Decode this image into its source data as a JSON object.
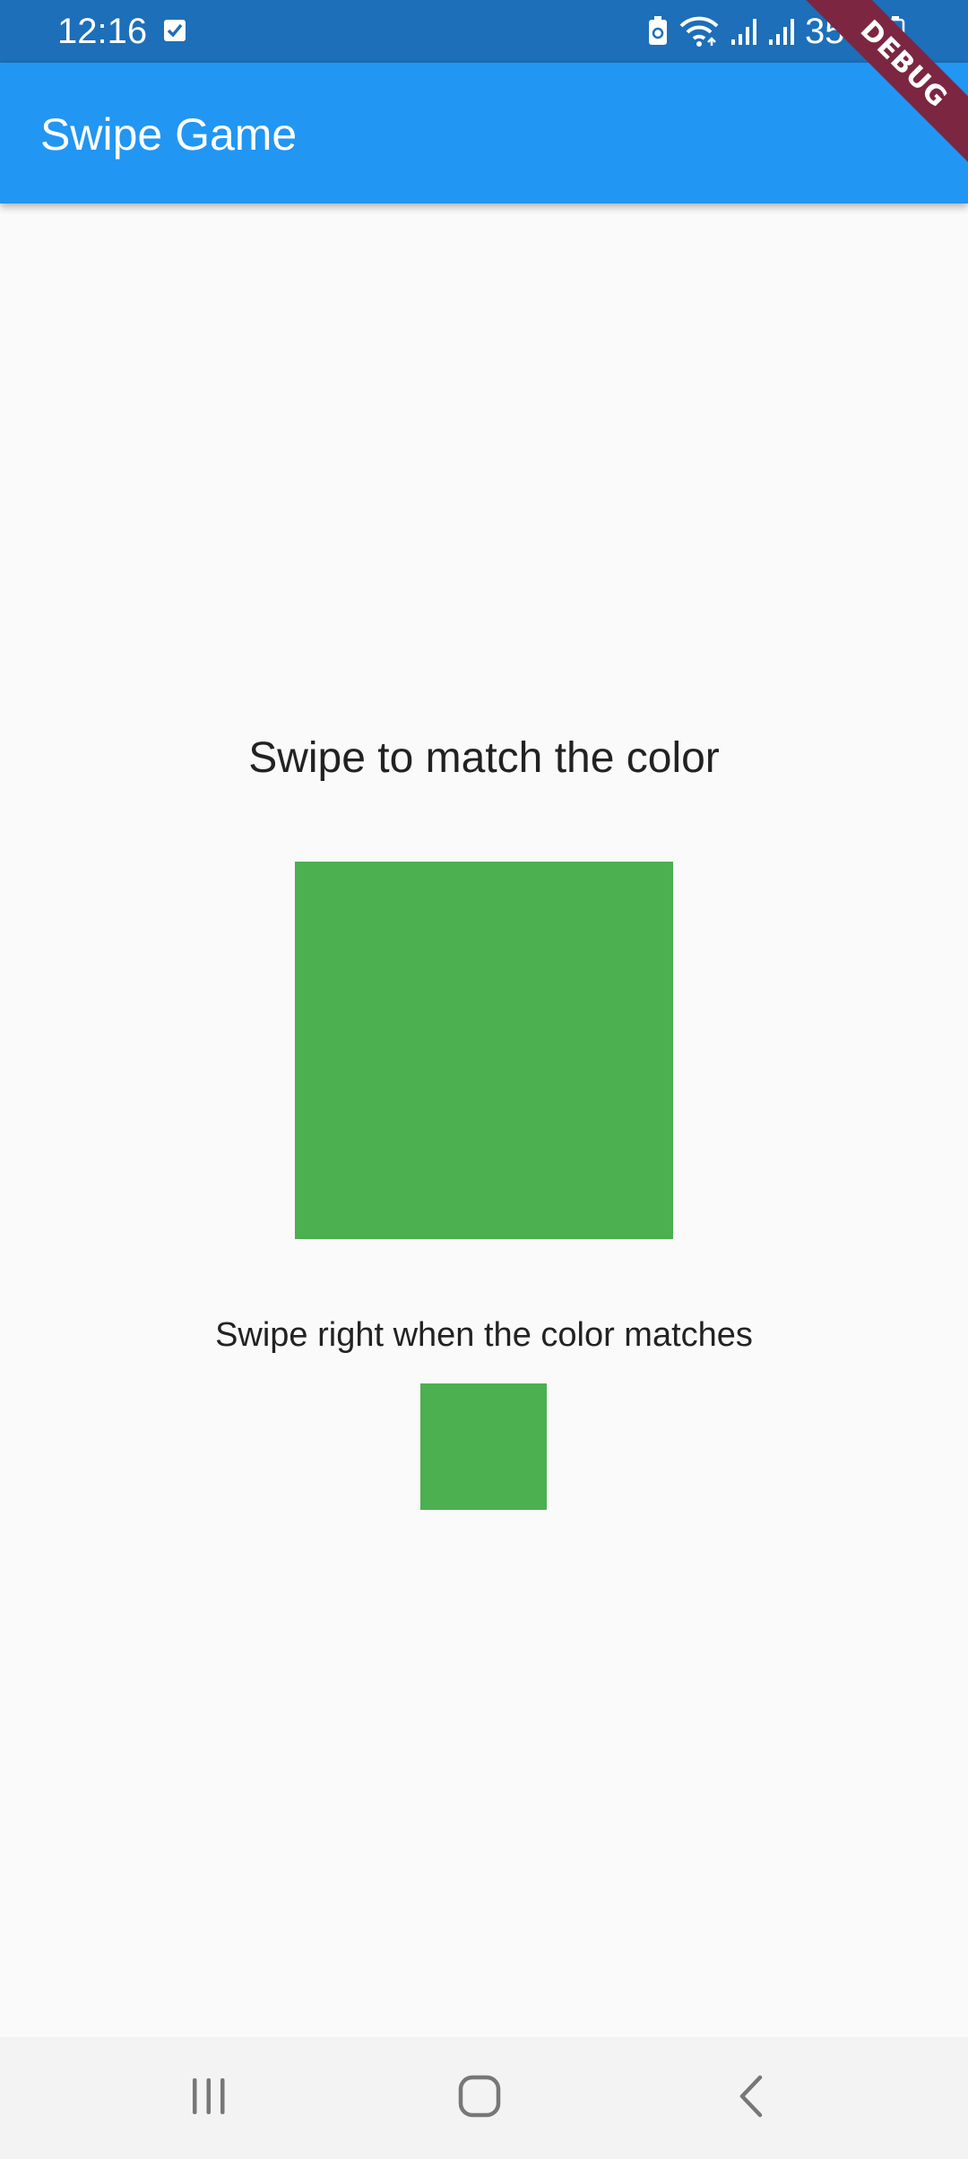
{
  "status_bar": {
    "time": "12:16",
    "battery_percent": "35%",
    "background_color": "#1c6fb8",
    "icons": [
      "check-box-icon",
      "battery-saver-icon",
      "wifi-icon",
      "signal-icon",
      "signal-icon",
      "battery-icon"
    ]
  },
  "app_bar": {
    "title": "Swipe Game",
    "background_color": "#2196f3"
  },
  "debug_banner": {
    "label": "DEBUG",
    "color": "#7c2642"
  },
  "game": {
    "instruction": "Swipe to match the color",
    "hint": "Swipe right when the color matches",
    "target_color": "#4caf50",
    "swipe_color": "#4caf50"
  },
  "nav_bar": {
    "buttons": [
      "recent-apps-icon",
      "home-icon",
      "back-icon"
    ]
  },
  "colors": {
    "background": "#fafafa",
    "text": "#222222"
  }
}
